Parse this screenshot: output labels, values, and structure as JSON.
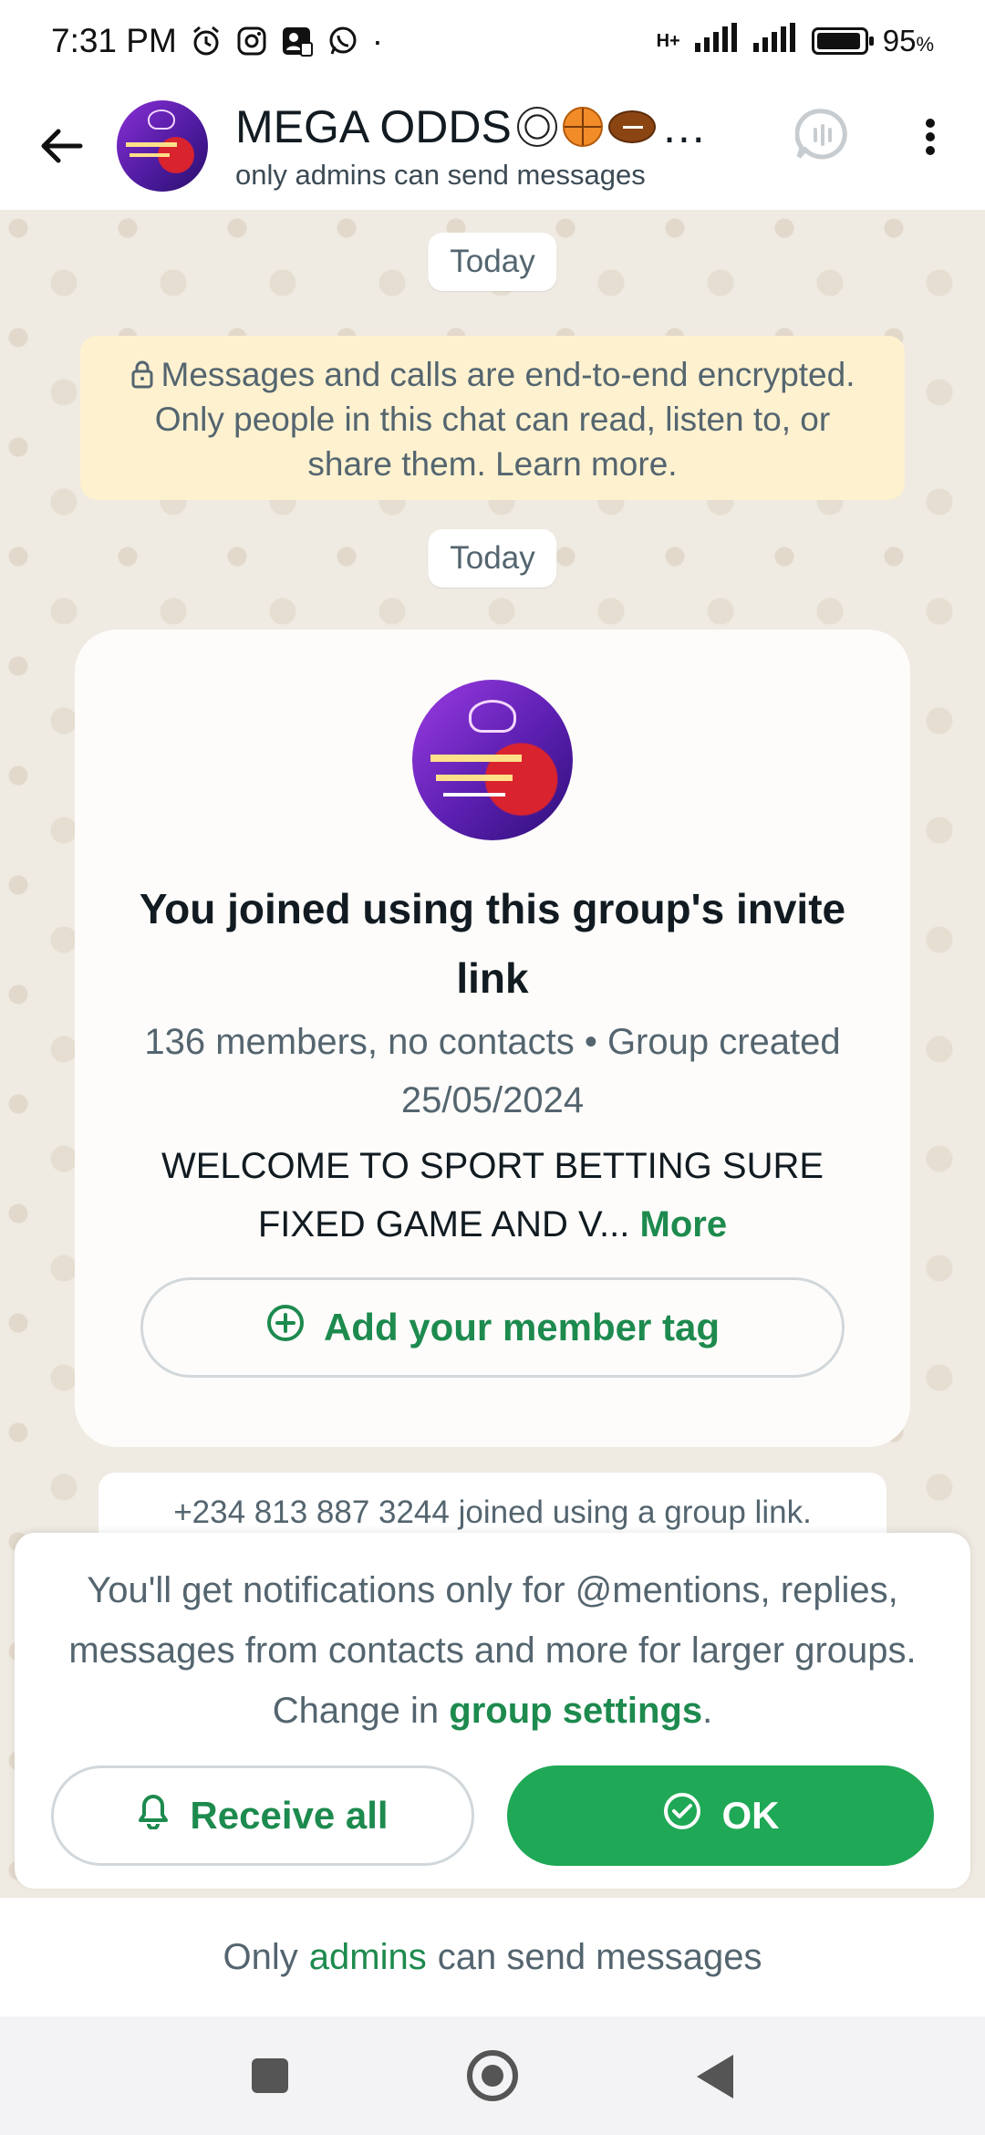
{
  "status_bar": {
    "time": "7:31 PM",
    "network": "H+",
    "battery": "95",
    "battery_unit": "%",
    "battery_level": 0.95,
    "dot": "·"
  },
  "header": {
    "title": "MEGA ODDS",
    "title_ellipsis": "…",
    "subtitle": "only admins can send messages"
  },
  "chat": {
    "date_top": "Today",
    "encryption_text": "Messages and calls are end-to-end encrypted. Only people in this chat can read, listen to, or share them. Learn more.",
    "date_second": "Today",
    "group_card": {
      "avatar_text_1": "PROGRAMMED GAMES",
      "avatar_text_2": "AVAILABLE NOW",
      "title": "You joined using this group's invite link",
      "meta": "136 members, no contacts • Group created 25/05/2024",
      "description": "WELCOME TO SPORT BETTING SURE FIXED GAME AND V...",
      "more_label": "More",
      "member_tag_button": "Add your member tag"
    },
    "join_message": "+234 813 887 3244 joined using a group link."
  },
  "notification_sheet": {
    "text_before": "You'll get notifications only for @mentions, replies, messages from contacts and more for larger groups. Change in",
    "settings_link": "group settings",
    "text_after": ".",
    "receive_all_label": "Receive all",
    "ok_label": "OK"
  },
  "footer": {
    "prefix": "Only",
    "admins_link": "admins",
    "suffix": "can send messages"
  },
  "colors": {
    "accent_green": "#1d8a4e",
    "ok_button_green": "#1fa855",
    "chat_background": "#efeae2",
    "encryption_background": "#fdf1d0"
  },
  "icons": [
    "back-arrow-icon",
    "alarm-icon",
    "instagram-icon",
    "contact-card-icon",
    "whatsapp-icon",
    "signal-icon",
    "battery-icon",
    "voice-chat-icon",
    "more-vert-icon",
    "lock-icon",
    "add-circle-icon",
    "bell-icon",
    "check-circle-icon",
    "recents-icon",
    "home-icon",
    "back-nav-icon"
  ]
}
